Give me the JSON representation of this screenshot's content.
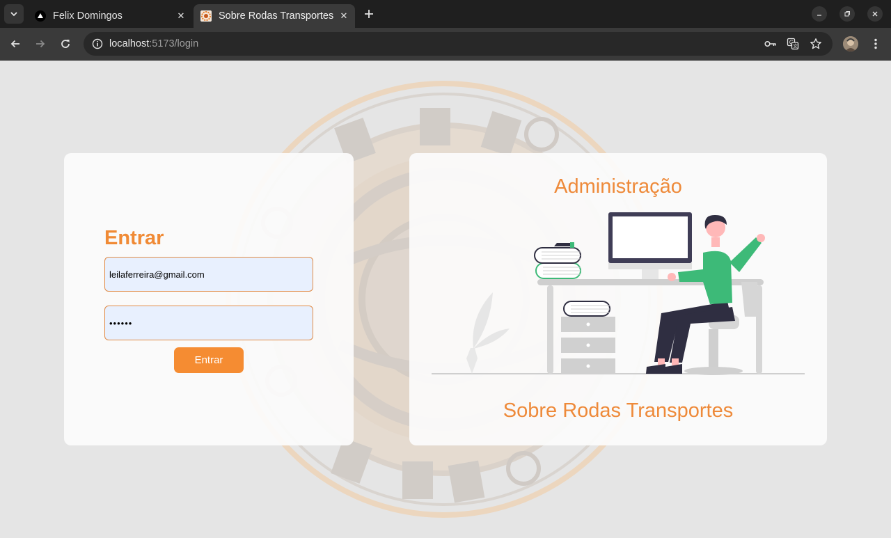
{
  "browser": {
    "tabs": [
      {
        "title": "Felix Domingos",
        "favicon": "triangle-logo-icon",
        "active": false
      },
      {
        "title": "Sobre Rodas Transportes",
        "favicon": "orange-gear-logo-icon",
        "active": true
      }
    ],
    "url_host": "localhost",
    "url_path": ":5173/login",
    "icons": [
      "tab-list-icon",
      "close-icon",
      "plus-icon",
      "minimize-icon",
      "restore-icon",
      "window-close-icon",
      "back-arrow-icon",
      "forward-arrow-icon",
      "reload-icon",
      "site-info-icon",
      "key-icon",
      "translate-icon",
      "star-icon",
      "avatar",
      "kebab-menu-icon"
    ]
  },
  "login": {
    "title": "Entrar",
    "email_value": "leilaferreira@gmail.com",
    "password_mask": "••••••",
    "submit_label": "Entrar"
  },
  "admin_panel": {
    "title": "Administração",
    "company_name": "Sobre Rodas Transportes"
  },
  "colors": {
    "accent": "#f58c32",
    "page_background": "#e5e5e5",
    "card_background": "#fcfcfc",
    "input_background": "#e8f0fe",
    "illustration_green": "#3dba78",
    "illustration_dark": "#2f2e41"
  }
}
